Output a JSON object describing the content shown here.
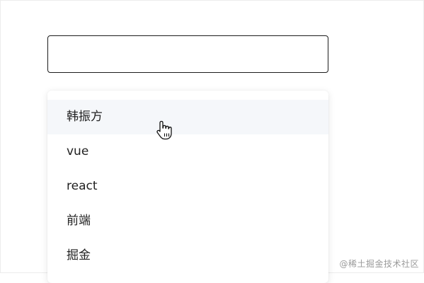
{
  "search": {
    "value": "",
    "placeholder": ""
  },
  "dropdown": {
    "items": [
      {
        "label": "韩振方"
      },
      {
        "label": "vue"
      },
      {
        "label": "react"
      },
      {
        "label": "前端"
      },
      {
        "label": "掘金"
      }
    ],
    "hovered_index": 0
  },
  "cursor": {
    "icon": "pointer-hand-icon"
  },
  "watermark": {
    "text": "@稀土掘金技术社区"
  },
  "colors": {
    "input_border": "#1c1c1c",
    "hover_background": "#f5f7fa",
    "item_text": "#222222",
    "watermark": "#9a9a9a"
  }
}
